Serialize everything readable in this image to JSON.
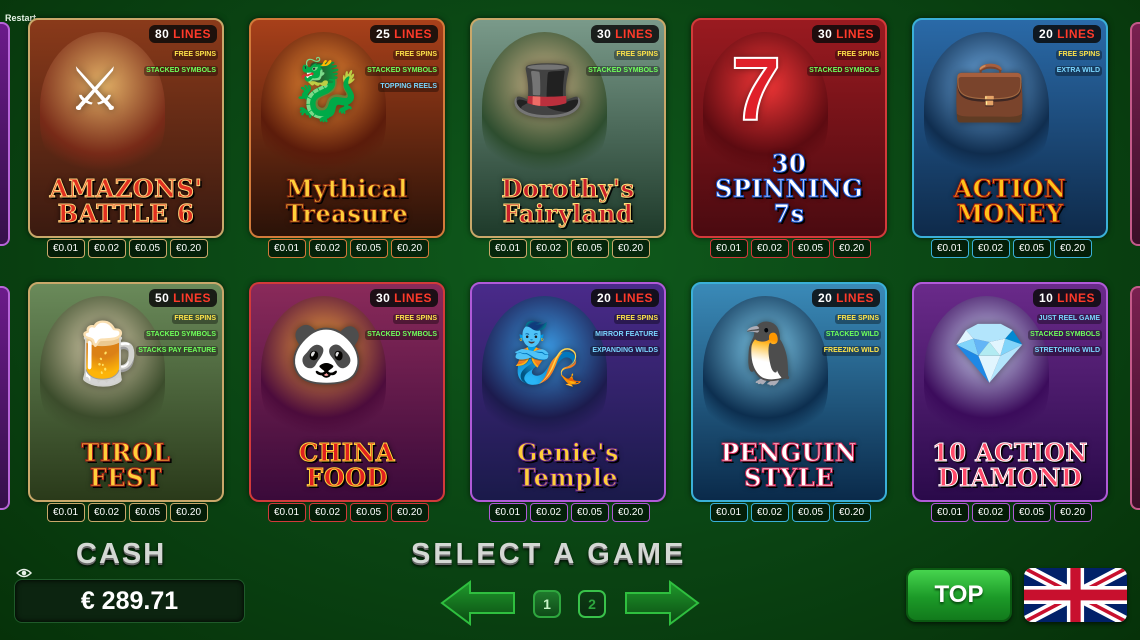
{
  "header": {
    "restart_label": "Restart"
  },
  "games": [
    {
      "title_line1": "AMAZONS'",
      "title_line2": "BATTLE 6",
      "lines_num": "80",
      "lines_label": "LINES",
      "features": [
        "FREE SPINS",
        "STACKED SYMBOLS"
      ],
      "bets": [
        "€0.01",
        "€0.02",
        "€0.05",
        "€0.20"
      ],
      "icon": "⚔",
      "colors": {
        "border": "#c9a86a",
        "bg1": "#3a1a10",
        "bg2": "#8a3a1a",
        "logo": "#e03020",
        "logo_stroke": "#ffd27a",
        "a1": "#f0c070",
        "a2": "#7a2a18"
      }
    },
    {
      "title_line1": "Mythical",
      "title_line2": "Treasure",
      "lines_num": "25",
      "lines_label": "LINES",
      "features": [
        "FREE SPINS",
        "STACKED SYMBOLS",
        "TOPPING REELS"
      ],
      "bets": [
        "€0.01",
        "€0.02",
        "€0.05",
        "€0.20"
      ],
      "icon": "🐉",
      "colors": {
        "border": "#d27a3a",
        "bg1": "#2a1208",
        "bg2": "#a8401a",
        "logo": "#ffcf3a",
        "logo_stroke": "#8a2a10",
        "a1": "#ff9a3a",
        "a2": "#5a1a0a"
      }
    },
    {
      "title_line1": "Dorothy's",
      "title_line2": "Fairyland",
      "lines_num": "30",
      "lines_label": "LINES",
      "features": [
        "FREE SPINS",
        "STACKED SYMBOLS"
      ],
      "bets": [
        "€0.01",
        "€0.02",
        "€0.05",
        "€0.20"
      ],
      "icon": "🎩",
      "colors": {
        "border": "#c9a86a",
        "bg1": "#1e3a2a",
        "bg2": "#7a9a8a",
        "logo": "#c8202a",
        "logo_stroke": "#ffe07a",
        "a1": "#d8b88a",
        "a2": "#2a4a2a"
      }
    },
    {
      "title_line1": "30",
      "title_line2": "SPINNING 7s",
      "lines_num": "30",
      "lines_label": "LINES",
      "features": [
        "FREE SPINS",
        "STACKED SYMBOLS"
      ],
      "bets": [
        "€0.01",
        "€0.02",
        "€0.05",
        "€0.20"
      ],
      "icon": "7",
      "colors": {
        "border": "#d23a3a",
        "bg1": "#4a0a10",
        "bg2": "#9a1a20",
        "logo": "#ffffff",
        "logo_stroke": "#1a5ad8",
        "a1": "#ff3a3a",
        "a2": "#5a0a10"
      }
    },
    {
      "title_line1": "ACTION",
      "title_line2": "MONEY",
      "lines_num": "20",
      "lines_label": "LINES",
      "features": [
        "FREE SPINS",
        "EXTRA WILD"
      ],
      "bets": [
        "€0.01",
        "€0.02",
        "€0.05",
        "€0.20"
      ],
      "icon": "💼",
      "colors": {
        "border": "#3ab0d8",
        "bg1": "#0e2a4a",
        "bg2": "#2a6aa8",
        "logo": "#ffc21a",
        "logo_stroke": "#a81a10",
        "a1": "#7ab8f0",
        "a2": "#0e2a4a"
      }
    },
    {
      "title_line1": "TIROL",
      "title_line2": "FEST",
      "lines_num": "50",
      "lines_label": "LINES",
      "features": [
        "FREE SPINS",
        "STACKED SYMBOLS",
        "STACKS PAY FEATURE"
      ],
      "bets": [
        "€0.01",
        "€0.02",
        "€0.05",
        "€0.20"
      ],
      "icon": "🍺",
      "colors": {
        "border": "#c9a86a",
        "bg1": "#2a3a1a",
        "bg2": "#6a8a5a",
        "logo": "#ffcf3a",
        "logo_stroke": "#a8201a",
        "a1": "#e8d8b8",
        "a2": "#3a4a2a"
      }
    },
    {
      "title_line1": "CHINA",
      "title_line2": "FOOD",
      "lines_num": "30",
      "lines_label": "LINES",
      "features": [
        "FREE SPINS",
        "STACKED SYMBOLS"
      ],
      "bets": [
        "€0.01",
        "€0.02",
        "€0.05",
        "€0.20"
      ],
      "icon": "🐼",
      "colors": {
        "border": "#d23a3a",
        "bg1": "#3a0a3a",
        "bg2": "#8a2a5a",
        "logo": "#e02020",
        "logo_stroke": "#ffd23a",
        "a1": "#ffb03a",
        "a2": "#4a0a3a"
      }
    },
    {
      "title_line1": "Genie's",
      "title_line2": "Temple",
      "lines_num": "20",
      "lines_label": "LINES",
      "features": [
        "FREE SPINS",
        "MIRROR FEATURE",
        "EXPANDING WILDS"
      ],
      "bets": [
        "€0.01",
        "€0.02",
        "€0.05",
        "€0.20"
      ],
      "icon": "🧞",
      "colors": {
        "border": "#b05ad8",
        "bg1": "#1a1a4a",
        "bg2": "#4a2a8a",
        "logo": "#ffcf3a",
        "logo_stroke": "#5a1a8a",
        "a1": "#3aa8f0",
        "a2": "#1a1a4a"
      }
    },
    {
      "title_line1": "PENGUIN",
      "title_line2": "STYLE",
      "lines_num": "20",
      "lines_label": "LINES",
      "features": [
        "FREE SPINS",
        "STACKED WILD",
        "FREEZING WILD"
      ],
      "bets": [
        "€0.01",
        "€0.02",
        "€0.05",
        "€0.20"
      ],
      "icon": "🐧",
      "colors": {
        "border": "#3ab0d8",
        "bg1": "#0a2a4a",
        "bg2": "#3a8ab8",
        "logo": "#ffffff",
        "logo_stroke": "#d82a5a",
        "a1": "#8ad8f8",
        "a2": "#0a2a4a"
      }
    },
    {
      "title_line1": "10 ACTION",
      "title_line2": "DIAMOND",
      "lines_num": "10",
      "lines_label": "LINES",
      "features": [
        "JUST REEL GAME",
        "STACKED SYMBOLS",
        "STRETCHING WILD"
      ],
      "bets": [
        "€0.01",
        "€0.02",
        "€0.05",
        "€0.20"
      ],
      "icon": "💎",
      "colors": {
        "border": "#b05ad8",
        "bg1": "#2a0a4a",
        "bg2": "#6a2a8a",
        "logo": "#ff4a6a",
        "logo_stroke": "#ffffff",
        "a1": "#d8e8ff",
        "a2": "#3a0a5a"
      }
    }
  ],
  "footer": {
    "cash_label": "CASH",
    "cash_value": "€ 289.71",
    "select_label": "SELECT A GAME",
    "pages": [
      "1",
      "2"
    ],
    "active_page": "2",
    "top_label": "TOP",
    "language": "English (UK flag)"
  }
}
